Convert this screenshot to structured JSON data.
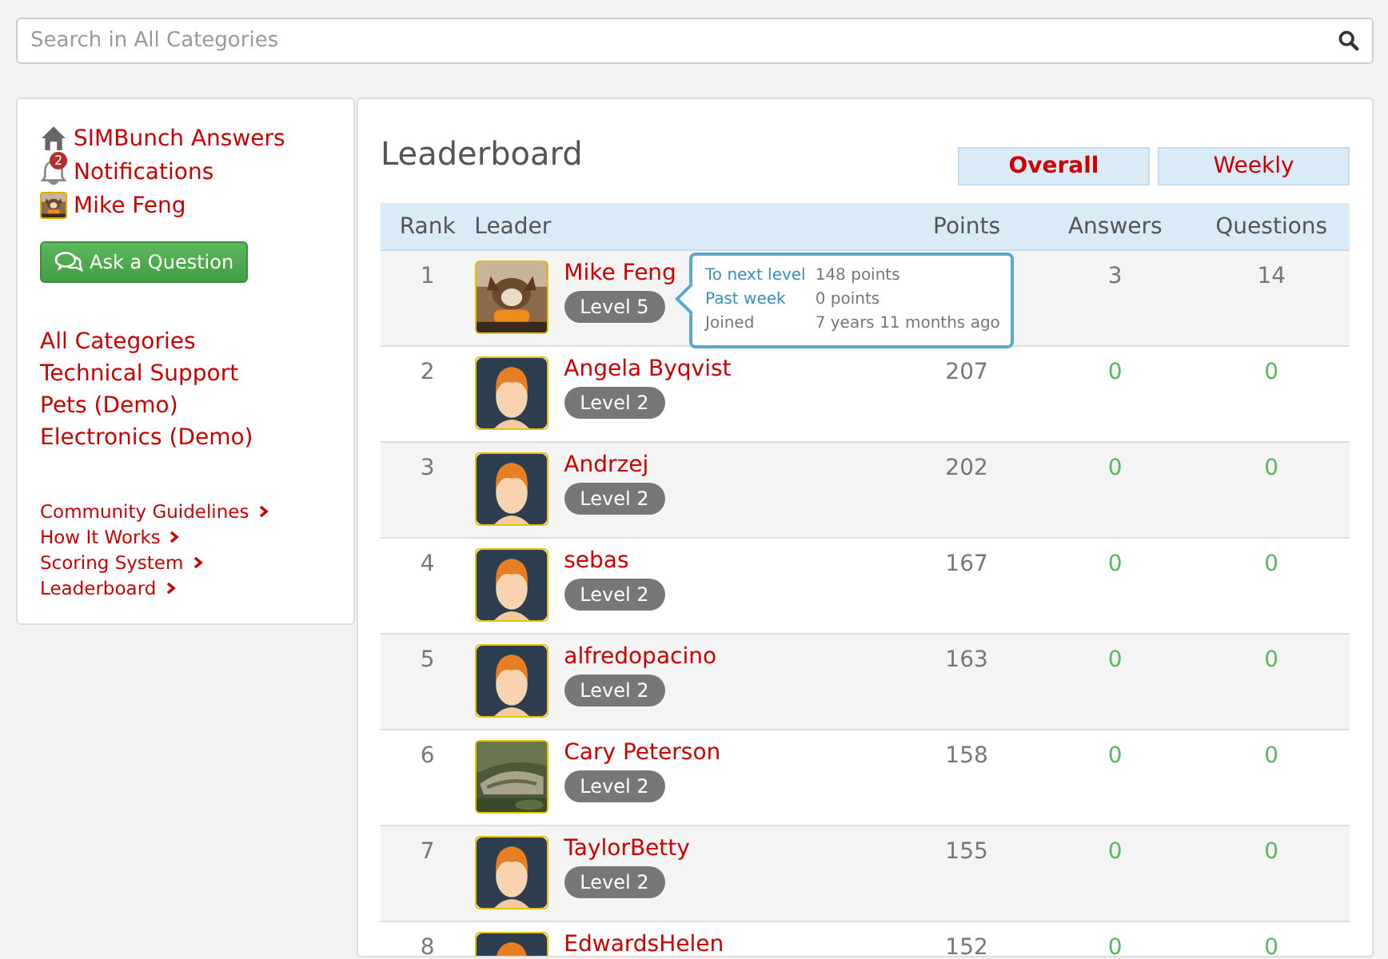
{
  "search": {
    "placeholder": "Search in All Categories"
  },
  "sidebar": {
    "links": [
      {
        "kind": "home",
        "label": "SIMBunch Answers"
      },
      {
        "kind": "notifications",
        "label": "Notifications",
        "badge": "2"
      },
      {
        "kind": "user",
        "label": "Mike Feng"
      }
    ],
    "ask_button": "Ask a Question",
    "categories": [
      "All Categories",
      "Technical Support",
      "Pets (Demo)",
      "Electronics (Demo)"
    ],
    "footer_links": [
      "Community Guidelines",
      "How It Works",
      "Scoring System",
      "Leaderboard"
    ]
  },
  "main": {
    "title": "Leaderboard",
    "tabs": [
      {
        "label": "Overall",
        "selected": true
      },
      {
        "label": "Weekly",
        "selected": false
      }
    ],
    "table": {
      "columns": [
        "Rank",
        "Leader",
        "Points",
        "Answers",
        "Questions"
      ],
      "rows": [
        {
          "rank": "1",
          "name": "Mike Feng",
          "level": "Level 5",
          "answers": "3",
          "questions": "14",
          "color": "#777777"
        },
        {
          "rank": "2",
          "avatar": {
            "kind": "figure"
          },
          "name": "Angela Byqvist",
          "level": "Level 2",
          "points": "207",
          "answers": "0",
          "questions": "0",
          "color": "#5cb85c"
        },
        {
          "rank": "3",
          "avatar": {
            "kind": "figure"
          },
          "name": "Andrzej",
          "level": "Level 2",
          "points": "202",
          "answers": "0",
          "questions": "0",
          "color": "#5cb85c"
        },
        {
          "rank": "4",
          "avatar": {
            "kind": "figure"
          },
          "name": "sebas",
          "level": "Level 2",
          "points": "167",
          "answers": "0",
          "questions": "0",
          "color": "#5cb85c"
        },
        {
          "rank": "5",
          "avatar": {
            "kind": "figure"
          },
          "name": "alfredopacino",
          "level": "Level 2",
          "points": "163",
          "answers": "0",
          "questions": "0",
          "color": "#5cb85c"
        },
        {
          "rank": "6",
          "name": "Cary Peterson",
          "level": "Level 2",
          "points": "158",
          "answers": "0",
          "questions": "0",
          "color": "#5cb85c"
        },
        {
          "rank": "7",
          "avatar": {
            "kind": "figure"
          },
          "name": "TaylorBetty",
          "level": "Level 2",
          "points": "155",
          "answers": "0",
          "questions": "0",
          "color": "#5cb85c"
        },
        {
          "rank": "8",
          "avatar": {
            "kind": "figure"
          },
          "name": "EdwardsHelen",
          "points": "152",
          "answers": "0",
          "questions": "0",
          "color": "#5cb85c"
        }
      ]
    },
    "tooltip": {
      "rows": [
        {
          "label": "To next level",
          "value": "148 points"
        },
        {
          "label": "Past week",
          "value": "0 points"
        },
        {
          "label": "Joined",
          "value": "7 years 11 months ago"
        }
      ]
    }
  }
}
